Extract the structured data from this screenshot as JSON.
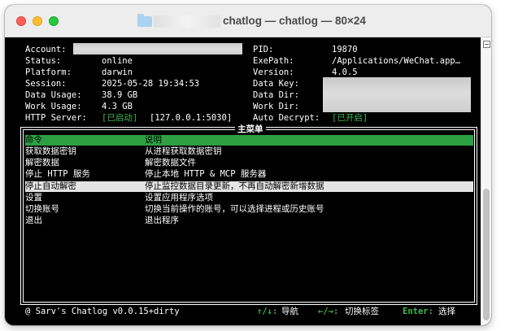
{
  "window": {
    "title": "chatlog — chatlog — 80×24"
  },
  "info": {
    "left": [
      {
        "label": "Account:",
        "value": ""
      },
      {
        "label": "Status:",
        "value": "online"
      },
      {
        "label": "Platform:",
        "value": "darwin"
      },
      {
        "label": "Session:",
        "value": "2025-05-28 19:34:53"
      },
      {
        "label": "Data Usage:",
        "value": "38.9 GB"
      },
      {
        "label": "Work Usage:",
        "value": "4.3 GB"
      }
    ],
    "right": [
      {
        "label": "PID:",
        "value": "19870"
      },
      {
        "label": "ExePath:",
        "value": "/Applications/WeChat.app…"
      },
      {
        "label": "Version:",
        "value": "4.0.5"
      },
      {
        "label": "Data Key:",
        "value": ""
      },
      {
        "label": "Data Dir:",
        "value": ""
      },
      {
        "label": "Work Dir:",
        "value": ""
      }
    ],
    "http_label": "HTTP Server:",
    "http_status": "[已启动]",
    "http_addr": "[127.0.0.1:5030]",
    "decrypt_label": "Auto Decrypt:",
    "decrypt_status": "[已开启]"
  },
  "menu": {
    "title": "主菜单",
    "header": {
      "cmd": "命令",
      "desc": "说明"
    },
    "items": [
      {
        "cmd": "获取数据密钥",
        "desc": "从进程获取数据密钥"
      },
      {
        "cmd": "解密数据",
        "desc": "解密数据文件"
      },
      {
        "cmd": "停止 HTTP 服务",
        "desc": "停止本地 HTTP & MCP 服务器"
      },
      {
        "cmd": "停止自动解密",
        "desc": "停止监控数据目录更新，不再自动解密新增数据"
      },
      {
        "cmd": "设置",
        "desc": "设置应用程序选项"
      },
      {
        "cmd": "切换账号",
        "desc": "切换当前操作的账号，可以选择进程或历史账号"
      },
      {
        "cmd": "退出",
        "desc": "退出程序"
      }
    ]
  },
  "statusbar": {
    "app": "@ Sarv's Chatlog v0.0.15+dirty",
    "nav_keys": "↑/↓:",
    "nav_label": "导航",
    "tab_keys": "←/→:",
    "tab_label": "切换标签",
    "enter_key": "Enter:",
    "enter_label": "选择"
  },
  "colors": {
    "accent_green": "#3fb950",
    "header_green": "#2ea043",
    "selection": "#e4e4e4"
  }
}
